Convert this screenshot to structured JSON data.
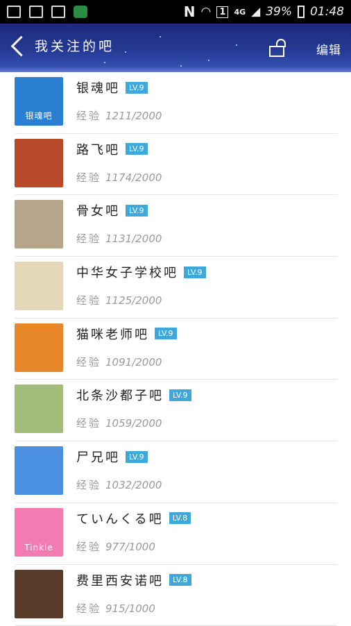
{
  "status_bar": {
    "network": "4G",
    "sim": "1",
    "battery": "39%",
    "time": "01:48",
    "carrier_icon": "N"
  },
  "header": {
    "title": "我关注的吧",
    "edit_label": "编辑"
  },
  "forums": [
    {
      "name": "银魂吧",
      "level": "LV.9",
      "exp_label": "经验",
      "exp": "1211/2000",
      "avatar_color": "#2a7fd0",
      "avatar_text": "银魂吧"
    },
    {
      "name": "路飞吧",
      "level": "LV.9",
      "exp_label": "经验",
      "exp": "1174/2000",
      "avatar_color": "#b84a2a",
      "avatar_text": ""
    },
    {
      "name": "骨女吧",
      "level": "LV.9",
      "exp_label": "经验",
      "exp": "1131/2000",
      "avatar_color": "#b7a58a",
      "avatar_text": ""
    },
    {
      "name": "中华女子学校吧",
      "level": "LV.9",
      "exp_label": "经验",
      "exp": "1125/2000",
      "avatar_color": "#e3d7b8",
      "avatar_text": ""
    },
    {
      "name": "猫咪老师吧",
      "level": "LV.9",
      "exp_label": "经验",
      "exp": "1091/2000",
      "avatar_color": "#e8862a",
      "avatar_text": ""
    },
    {
      "name": "北条沙都子吧",
      "level": "LV.9",
      "exp_label": "经验",
      "exp": "1059/2000",
      "avatar_color": "#a3bd7a",
      "avatar_text": ""
    },
    {
      "name": "尸兄吧",
      "level": "LV.9",
      "exp_label": "经验",
      "exp": "1032/2000",
      "avatar_color": "#4a8fe0",
      "avatar_text": ""
    },
    {
      "name": "ていんくる吧",
      "level": "LV.8",
      "exp_label": "经验",
      "exp": "977/1000",
      "avatar_color": "#f27bb1",
      "avatar_text": "Tinkle"
    },
    {
      "name": "费里西安诺吧",
      "level": "LV.8",
      "exp_label": "经验",
      "exp": "915/1000",
      "avatar_color": "#5a3a28",
      "avatar_text": ""
    }
  ]
}
